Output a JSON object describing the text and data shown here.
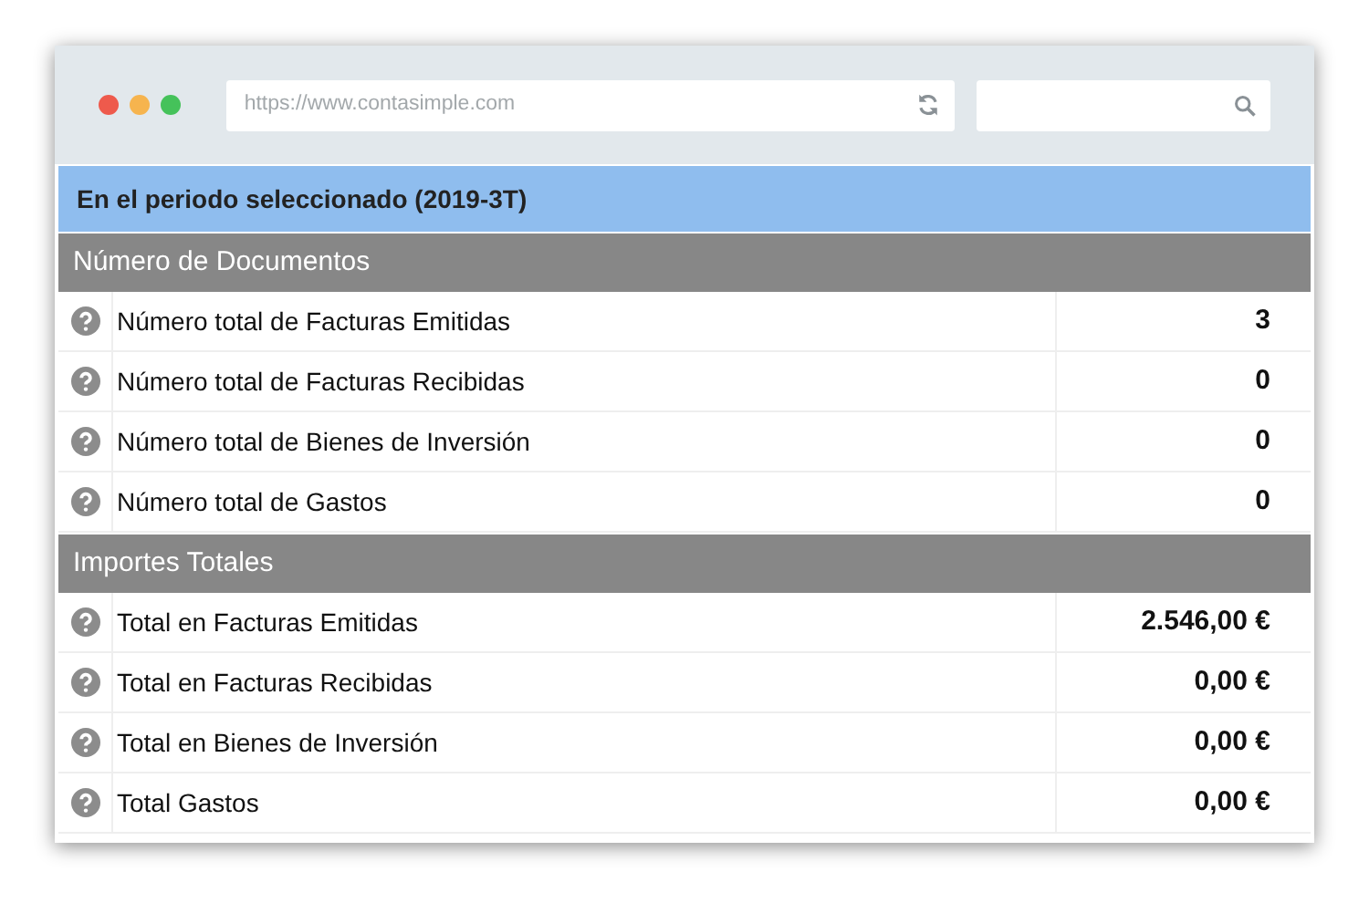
{
  "browser": {
    "address": "https://www.contasimple.com"
  },
  "title": "En el periodo seleccionado (2019-3T)",
  "sections": [
    {
      "heading": "Número de Documentos",
      "rows": [
        {
          "label": "Número total de Facturas Emitidas",
          "value": "3"
        },
        {
          "label": "Número total de Facturas Recibidas",
          "value": "0"
        },
        {
          "label": "Número total de Bienes de Inversión",
          "value": "0"
        },
        {
          "label": "Número total de Gastos",
          "value": "0"
        }
      ]
    },
    {
      "heading": "Importes Totales",
      "rows": [
        {
          "label": "Total en Facturas Emitidas",
          "value": "2.546,00 €"
        },
        {
          "label": "Total en Facturas Recibidas",
          "value": "0,00 €"
        },
        {
          "label": "Total en Bienes de Inversión",
          "value": "0,00 €"
        },
        {
          "label": "Total Gastos",
          "value": "0,00 €"
        }
      ]
    }
  ]
}
